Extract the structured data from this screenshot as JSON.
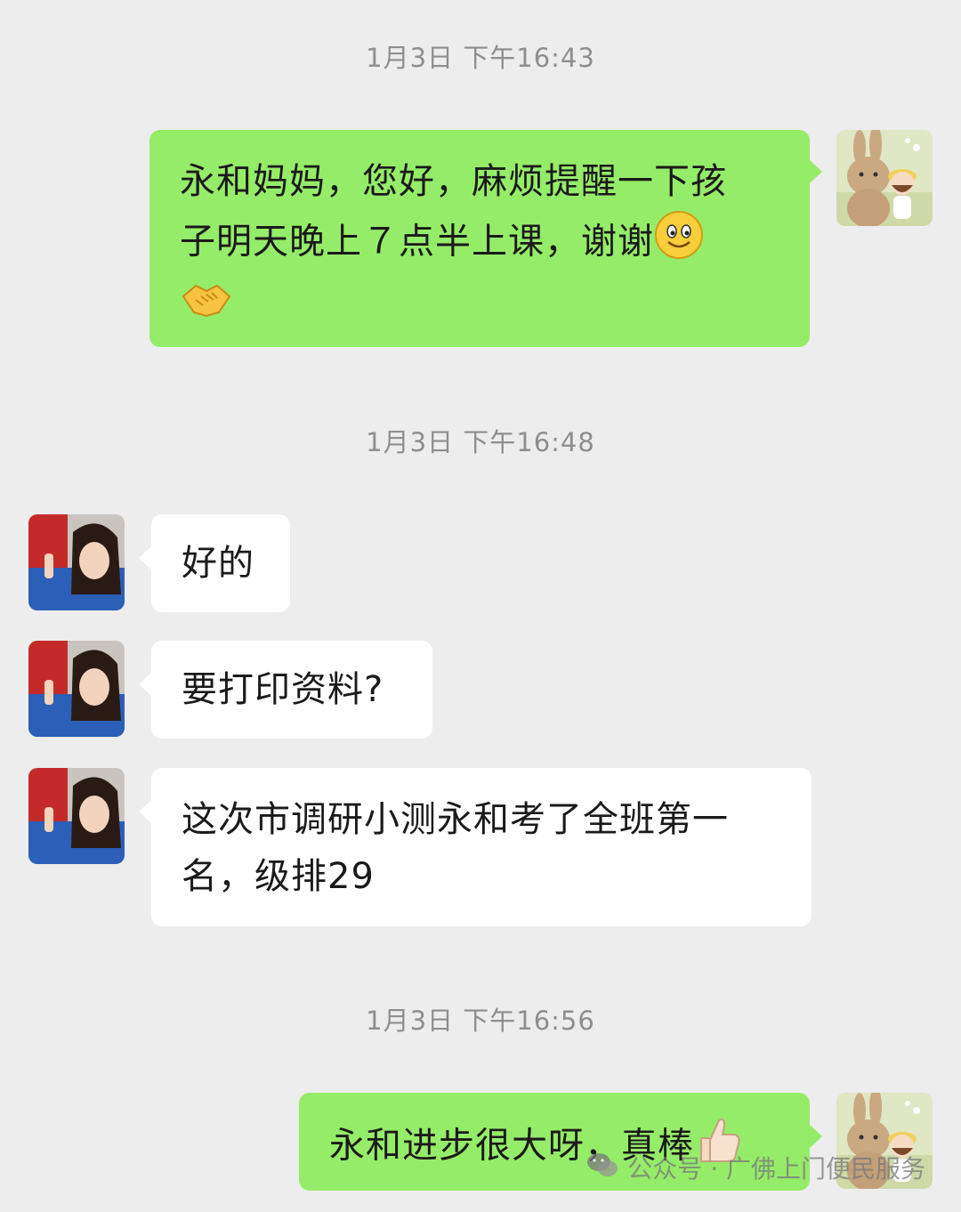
{
  "timestamps": [
    "1月3日 下午16:43",
    "1月3日 下午16:48",
    "1月3日 下午16:56"
  ],
  "messages": [
    {
      "side": "out",
      "line1": "永和妈妈，您好，麻烦提醒一下孩",
      "line2": "子明天晚上７点半上课，谢谢",
      "emojis": [
        "smile-emoji",
        "handshake-emoji"
      ]
    },
    {
      "side": "in",
      "text": "好的"
    },
    {
      "side": "in",
      "text": "要打印资料?"
    },
    {
      "side": "in",
      "line1": "这次市调研小测永和考了全班第一",
      "line2": "名，级排29"
    },
    {
      "side": "out",
      "text": "永和进步很大呀，真棒",
      "emojis": [
        "thumbs-up-emoji"
      ]
    }
  ],
  "watermark": {
    "text": "公众号 · 广佛上门便民服务",
    "icon": "wechat-icon"
  },
  "colors": {
    "background": "#ededed",
    "outgoing_bubble": "#95ec69",
    "incoming_bubble": "#ffffff",
    "timestamp": "#8e8e8e"
  }
}
